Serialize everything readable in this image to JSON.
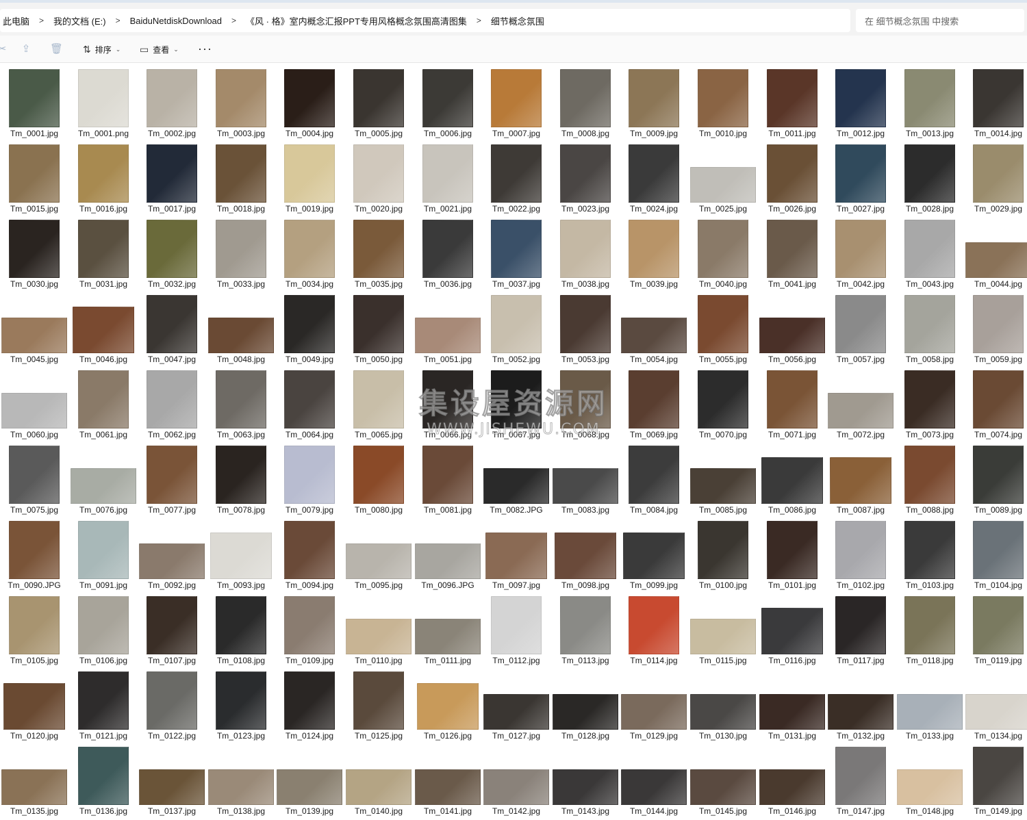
{
  "address": {
    "crumbs": [
      "此电脑",
      "我的文档 (E:)",
      "BaiduNetdiskDownload",
      "《风 · 格》室内概念汇报PPT专用风格概念氛围高清图集",
      "细节概念氛围"
    ],
    "separator": ">"
  },
  "search": {
    "placeholder": "在 细节概念氛围 中搜索"
  },
  "toolbar": {
    "sort_label": "排序",
    "view_label": "查看",
    "more_label": "···"
  },
  "watermark": {
    "main": "集设屋资源网",
    "sub": "WWW.JISHEWU.COM"
  },
  "files": [
    "Tm_0001.jpg",
    "Tm_0001.png",
    "Tm_0002.jpg",
    "Tm_0003.jpg",
    "Tm_0004.jpg",
    "Tm_0005.jpg",
    "Tm_0006.jpg",
    "Tm_0007.jpg",
    "Tm_0008.jpg",
    "Tm_0009.jpg",
    "Tm_0010.jpg",
    "Tm_0011.jpg",
    "Tm_0012.jpg",
    "Tm_0013.jpg",
    "Tm_0014.jpg",
    "Tm_0015.jpg",
    "Tm_0016.jpg",
    "Tm_0017.jpg",
    "Tm_0018.jpg",
    "Tm_0019.jpg",
    "Tm_0020.jpg",
    "Tm_0021.jpg",
    "Tm_0022.jpg",
    "Tm_0023.jpg",
    "Tm_0024.jpg",
    "Tm_0025.jpg",
    "Tm_0026.jpg",
    "Tm_0027.jpg",
    "Tm_0028.jpg",
    "Tm_0029.jpg",
    "Tm_0030.jpg",
    "Tm_0031.jpg",
    "Tm_0032.jpg",
    "Tm_0033.jpg",
    "Tm_0034.jpg",
    "Tm_0035.jpg",
    "Tm_0036.jpg",
    "Tm_0037.jpg",
    "Tm_0038.jpg",
    "Tm_0039.jpg",
    "Tm_0040.jpg",
    "Tm_0041.jpg",
    "Tm_0042.jpg",
    "Tm_0043.jpg",
    "Tm_0044.jpg",
    "Tm_0045.jpg",
    "Tm_0046.jpg",
    "Tm_0047.jpg",
    "Tm_0048.jpg",
    "Tm_0049.jpg",
    "Tm_0050.jpg",
    "Tm_0051.jpg",
    "Tm_0052.jpg",
    "Tm_0053.jpg",
    "Tm_0054.jpg",
    "Tm_0055.jpg",
    "Tm_0056.jpg",
    "Tm_0057.jpg",
    "Tm_0058.jpg",
    "Tm_0059.jpg",
    "Tm_0060.jpg",
    "Tm_0061.jpg",
    "Tm_0062.jpg",
    "Tm_0063.jpg",
    "Tm_0064.jpg",
    "Tm_0065.jpg",
    "Tm_0066.jpg",
    "Tm_0067.jpg",
    "Tm_0068.jpg",
    "Tm_0069.jpg",
    "Tm_0070.jpg",
    "Tm_0071.jpg",
    "Tm_0072.jpg",
    "Tm_0073.jpg",
    "Tm_0074.jpg",
    "Tm_0075.jpg",
    "Tm_0076.jpg",
    "Tm_0077.jpg",
    "Tm_0078.jpg",
    "Tm_0079.jpg",
    "Tm_0080.jpg",
    "Tm_0081.jpg",
    "Tm_0082.JPG",
    "Tm_0083.jpg",
    "Tm_0084.jpg",
    "Tm_0085.jpg",
    "Tm_0086.jpg",
    "Tm_0087.jpg",
    "Tm_0088.jpg",
    "Tm_0089.jpg",
    "Tm_0090.JPG",
    "Tm_0091.jpg",
    "Tm_0092.jpg",
    "Tm_0093.jpg",
    "Tm_0094.jpg",
    "Tm_0095.jpg",
    "Tm_0096.JPG",
    "Tm_0097.jpg",
    "Tm_0098.jpg",
    "Tm_0099.jpg",
    "Tm_0100.jpg",
    "Tm_0101.jpg",
    "Tm_0102.jpg",
    "Tm_0103.jpg",
    "Tm_0104.jpg",
    "Tm_0105.jpg",
    "Tm_0106.jpg",
    "Tm_0107.jpg",
    "Tm_0108.jpg",
    "Tm_0109.jpg",
    "Tm_0110.jpg",
    "Tm_0111.jpg",
    "Tm_0112.jpg",
    "Tm_0113.jpg",
    "Tm_0114.jpg",
    "Tm_0115.jpg",
    "Tm_0116.jpg",
    "Tm_0117.jpg",
    "Tm_0118.jpg",
    "Tm_0119.jpg",
    "Tm_0120.jpg",
    "Tm_0121.jpg",
    "Tm_0122.jpg",
    "Tm_0123.jpg",
    "Tm_0124.jpg",
    "Tm_0125.jpg",
    "Tm_0126.jpg",
    "Tm_0127.jpg",
    "Tm_0128.jpg",
    "Tm_0129.jpg",
    "Tm_0130.jpg",
    "Tm_0131.jpg",
    "Tm_0132.jpg",
    "Tm_0133.jpg",
    "Tm_0134.jpg",
    "Tm_0135.jpg",
    "Tm_0136.jpg",
    "Tm_0137.jpg",
    "Tm_0138.jpg",
    "Tm_0139.jpg",
    "Tm_0140.jpg",
    "Tm_0141.jpg",
    "Tm_0142.jpg",
    "Tm_0143.jpg",
    "Tm_0144.jpg",
    "Tm_0145.jpg",
    "Tm_0146.jpg",
    "Tm_0147.jpg",
    "Tm_0148.jpg",
    "Tm_0149.jpg"
  ],
  "thumb_colors": [
    "#4a5a48",
    "#dcdad2",
    "#b9b2a6",
    "#a48a6a",
    "#2a1e18",
    "#3a3530",
    "#3c3a36",
    "#b87a38",
    "#6e6a62",
    "#8c7656",
    "#8a6444",
    "#5a3628",
    "#24344e",
    "#8a8a72",
    "#3a3632",
    "#8a7250",
    "#a88a50",
    "#222a38",
    "#6a5238",
    "#d8c89a",
    "#d0c8bc",
    "#c8c4bc",
    "#3e3a36",
    "#4a4644",
    "#3a3a3a",
    "#c0beb8",
    "#6a5036",
    "#304a5c",
    "#2c2c2c",
    "#9a8c6c",
    "#2a2420",
    "#5a5040",
    "#6a6a3a",
    "#a09a90",
    "#b4a080",
    "#7a5a3a",
    "#3a3a3a",
    "#3a5068",
    "#c4b8a4",
    "#b89468",
    "#8a7a68",
    "#6a5a4a",
    "#a89070",
    "#a8a8a8",
    "#8a7258",
    "#9a7a5c",
    "#7a4a30",
    "#3a3632",
    "#6a4a34",
    "#2a2826",
    "#3a302c",
    "#a88a78",
    "#c8bfae",
    "#4a3a32",
    "#5a4a40",
    "#7a4a30",
    "#4a3028",
    "#8a8a8a",
    "#a4a49c",
    "#a8a09a",
    "#b8b8b8",
    "#8a7a68",
    "#a8a8a8",
    "#6e6a64",
    "#4a4440",
    "#c8bea8",
    "#2a2624",
    "#1c1c1c",
    "#6a5a48",
    "#5a3e30",
    "#2c2c2c",
    "#7a5436",
    "#a09a90",
    "#3a2c24",
    "#6a4a34",
    "#5a5a5a",
    "#a8aca4",
    "#7a5438",
    "#2a2420",
    "#b8bcd0",
    "#8a4a28",
    "#6a4a38",
    "#2a2a2a",
    "#4a4a4a",
    "#3c3c3c",
    "#4a4036",
    "#3a3a3a",
    "#8a6038",
    "#7a4a30",
    "#3a3c38",
    "#7a5438",
    "#a8b8b8",
    "#8a7a6c",
    "#dcdad4",
    "#6a4a38",
    "#b8b4ac",
    "#a8a6a0",
    "#8a6a54",
    "#6a4a3a",
    "#3a3a3a",
    "#3a3630",
    "#3a2a24",
    "#a8a8ac",
    "#3a3a3a",
    "#6a7278",
    "#a89470",
    "#a8a49a",
    "#3a2e26",
    "#2a2a2a",
    "#8a7c70",
    "#c8b494",
    "#8a8478",
    "#d4d4d4",
    "#8a8a86",
    "#c84a30",
    "#c8bca0",
    "#3a3a3c",
    "#2a2626",
    "#7a7458",
    "#7a7a60",
    "#6a4a32",
    "#2e2c2c",
    "#6a6a66",
    "#2a2c2e",
    "#2a2624",
    "#5a4a3c",
    "#c89a5a",
    "#3a3632",
    "#2a2826",
    "#7a6a5c",
    "#4a4846",
    "#3a2a24",
    "#3a2e26",
    "#a8b0b8",
    "#d8d4cc",
    "#8a7256",
    "#3e5a5a",
    "#6a5438",
    "#9a8a78",
    "#8a8070",
    "#b4a484",
    "#6a5a4a",
    "#8a827a",
    "#3a3838",
    "#3a3838",
    "#5a4a40",
    "#4a3a2e",
    "#7a7878",
    "#d8c0a0",
    "#4a4642"
  ],
  "thumb_shapes": [
    "tall",
    "tall",
    "tall",
    "tall",
    "tall",
    "tall",
    "tall",
    "tall",
    "tall",
    "tall",
    "tall",
    "tall",
    "tall",
    "tall",
    "tall",
    "tall",
    "tall",
    "tall",
    "tall",
    "tall",
    "tall",
    "tall",
    "tall",
    "tall",
    "tall",
    "wide",
    "tall",
    "tall",
    "tall",
    "tall",
    "tall",
    "tall",
    "tall",
    "tall",
    "tall",
    "tall",
    "tall",
    "tall",
    "tall",
    "tall",
    "tall",
    "tall",
    "tall",
    "tall",
    "wide",
    "wide",
    "mid",
    "tall",
    "wide",
    "tall",
    "tall",
    "wide",
    "tall",
    "tall",
    "wide",
    "tall",
    "wide",
    "tall",
    "tall",
    "tall",
    "wide",
    "tall",
    "tall",
    "tall",
    "tall",
    "tall",
    "tall",
    "tall",
    "tall",
    "tall",
    "tall",
    "tall",
    "wide",
    "tall",
    "tall",
    "tall",
    "wide",
    "tall",
    "tall",
    "tall",
    "tall",
    "tall",
    "wide",
    "wide",
    "tall",
    "wide",
    "mid",
    "mid",
    "tall",
    "tall",
    "tall",
    "tall",
    "wide",
    "mid",
    "tall",
    "wide",
    "wide",
    "mid",
    "mid",
    "mid",
    "tall",
    "tall",
    "tall",
    "tall",
    "tall",
    "tall",
    "tall",
    "tall",
    "tall",
    "tall",
    "wide",
    "wide",
    "tall",
    "tall",
    "tall",
    "wide",
    "mid",
    "tall",
    "tall",
    "tall",
    "mid",
    "tall",
    "tall",
    "tall",
    "tall",
    "tall",
    "mid",
    "wide",
    "wide",
    "wide",
    "wide",
    "wide",
    "wide",
    "wide",
    "wide",
    "wide",
    "tall",
    "wide",
    "wide",
    "wide",
    "wide",
    "wide",
    "wide",
    "wide",
    "wide",
    "wide",
    "wide",
    "tall",
    "wide",
    "tall"
  ]
}
